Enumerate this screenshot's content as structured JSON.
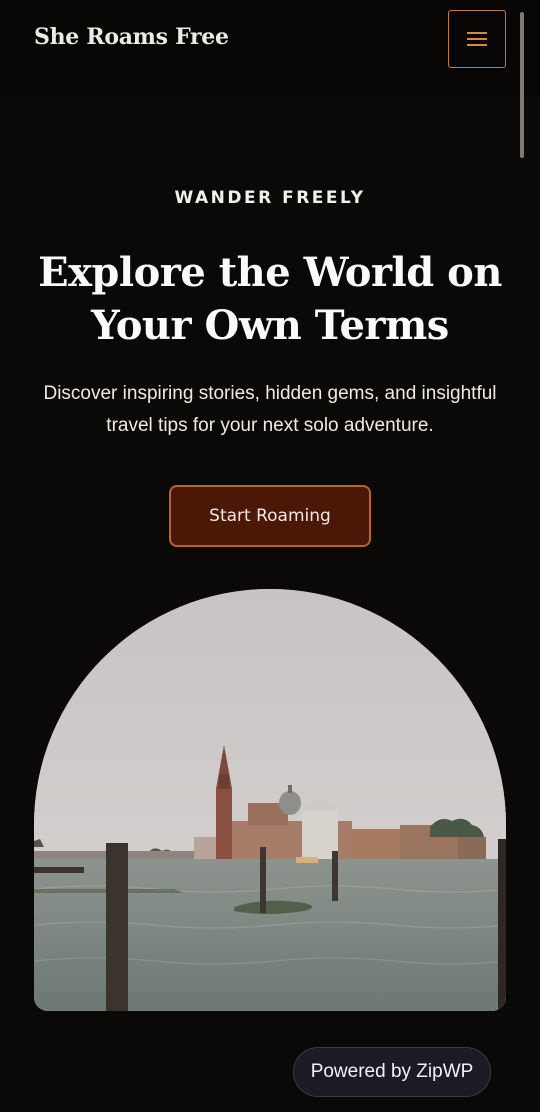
{
  "header": {
    "site_title": "She Roams Free",
    "menu_icon": "hamburger-menu-icon",
    "accent_color": "#d98a36"
  },
  "hero": {
    "eyebrow": "WANDER FREELY",
    "title": "Explore the World on Your Own Terms",
    "subtitle": "Discover inspiring stories, hidden gems, and insightful travel tips for your next solo adventure.",
    "cta_label": "Start Roaming",
    "cta_color": "#4b1707"
  },
  "footer_badge": {
    "label": "Powered by ZipWP"
  }
}
